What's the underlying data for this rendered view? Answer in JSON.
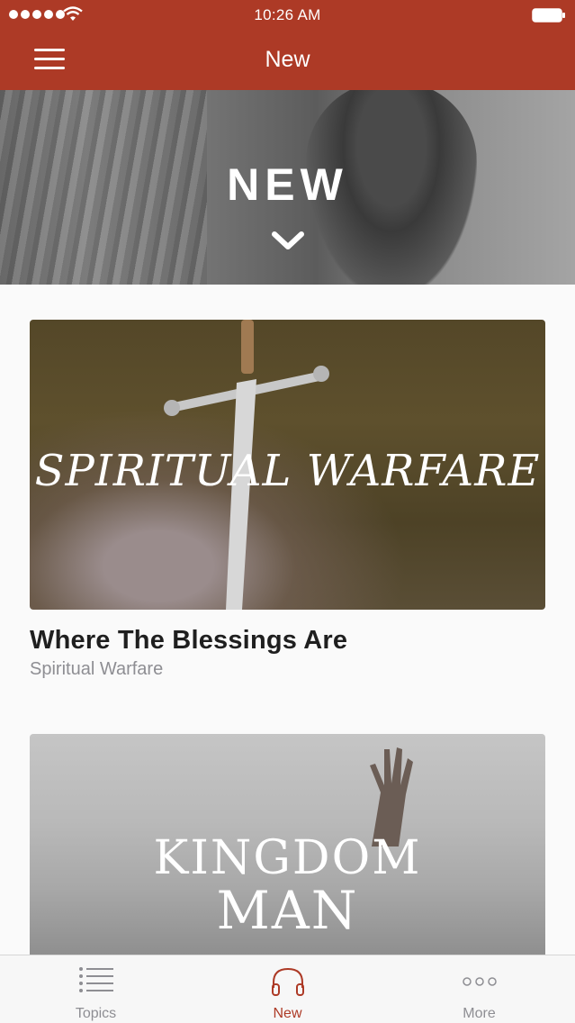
{
  "status_bar": {
    "time": "10:26 AM",
    "signal_dots": 5
  },
  "nav": {
    "title": "New"
  },
  "hero": {
    "title": "NEW"
  },
  "cards": [
    {
      "art_text": "SPIRITUAL WARFARE",
      "title": "Where The Blessings Are",
      "subtitle": "Spiritual Warfare"
    },
    {
      "art_text_line1": "KINGDOM",
      "art_text_line2": "MAN"
    }
  ],
  "tabs": [
    {
      "label": "Topics",
      "icon": "list-icon",
      "active": false
    },
    {
      "label": "New",
      "icon": "headphones-icon",
      "active": true
    },
    {
      "label": "More",
      "icon": "more-dots-icon",
      "active": false
    }
  ],
  "colors": {
    "brand": "#ad3a26",
    "inactive": "#8e8e93",
    "title_text": "#1f1f1f"
  }
}
